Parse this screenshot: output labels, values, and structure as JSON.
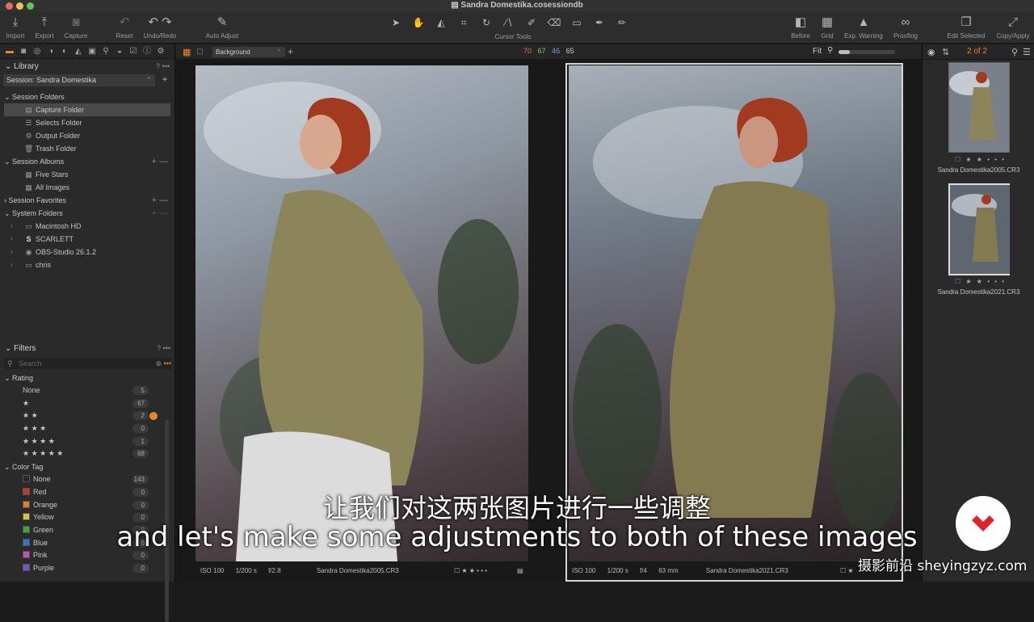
{
  "window": {
    "title": "Sandra Domestika.cosessiondb"
  },
  "toolbar": {
    "import": "Import",
    "export": "Export",
    "capture": "Capture",
    "reset": "Reset",
    "undo_redo": "Undo/Redo",
    "auto_adjust": "Auto Adjust",
    "cursor_tools": "Cursor Tools",
    "before": "Before",
    "grid": "Grid",
    "exp_warning": "Exp. Warning",
    "proofing": "Proofing",
    "edit_selected": "Edit Selected",
    "copy_apply": "Copy/Apply"
  },
  "library": {
    "title": "Library",
    "session": "Session: Sandra Domestika",
    "session_folders": "Session Folders",
    "folders": [
      "Capture Folder",
      "Selects Folder",
      "Output Folder",
      "Trash Folder"
    ],
    "session_albums": "Session Albums",
    "albums": [
      "Five Stars",
      "All Images"
    ],
    "session_favorites": "Session Favorites",
    "system_folders": "System Folders",
    "system": [
      "Macintosh HD",
      "SCARLETT",
      "OBS-Studio 26.1.2",
      "chris"
    ]
  },
  "filters": {
    "title": "Filters",
    "search_placeholder": "Search",
    "rating_title": "Rating",
    "ratings": [
      {
        "label": "None",
        "count": "5"
      },
      {
        "label": "★",
        "count": "67"
      },
      {
        "label": "★ ★",
        "count": "2"
      },
      {
        "label": "★ ★ ★",
        "count": "0"
      },
      {
        "label": "★ ★ ★ ★",
        "count": "1"
      },
      {
        "label": "★ ★ ★ ★ ★",
        "count": "68"
      }
    ],
    "color_title": "Color Tag",
    "colors": [
      {
        "label": "None",
        "count": "143",
        "color": "#2a2a2a"
      },
      {
        "label": "Red",
        "count": "0",
        "color": "#c0392b"
      },
      {
        "label": "Orange",
        "count": "0",
        "color": "#d9822b"
      },
      {
        "label": "Yellow",
        "count": "0",
        "color": "#d4c435"
      },
      {
        "label": "Green",
        "count": "0",
        "color": "#3fa33f"
      },
      {
        "label": "Blue",
        "count": "0",
        "color": "#3a6fd0"
      },
      {
        "label": "Pink",
        "count": "0",
        "color": "#c24fb7"
      },
      {
        "label": "Purple",
        "count": "0",
        "color": "#7a4fc2"
      }
    ]
  },
  "viewer": {
    "background": "Background",
    "rgb": [
      "70",
      "67",
      "46",
      "65"
    ],
    "fit": "Fit",
    "img1": {
      "iso": "ISO 100",
      "shutter": "1/200 s",
      "aperture": "f/2.8",
      "name": "Sandra Domestika2005.CR3"
    },
    "img2": {
      "iso": "ISO 100",
      "shutter": "1/200 s",
      "aperture": "f/4",
      "focal": "63 mm",
      "name": "Sandra Domestika2021.CR3"
    }
  },
  "browser": {
    "count": "2 of 2",
    "thumbs": [
      {
        "name": "Sandra Domestika2005.CR3",
        "stars": "★ ★ • • •"
      },
      {
        "name": "Sandra Domestika2021.CR3",
        "stars": "★ ★ • • •"
      }
    ]
  },
  "subtitles": {
    "cn": "让我们对这两张图片进行一些调整",
    "en": "and let's make some adjustments to both of these images"
  },
  "watermark": "摄影前沿 sheyingzyz.com",
  "accent": "#e8862e"
}
